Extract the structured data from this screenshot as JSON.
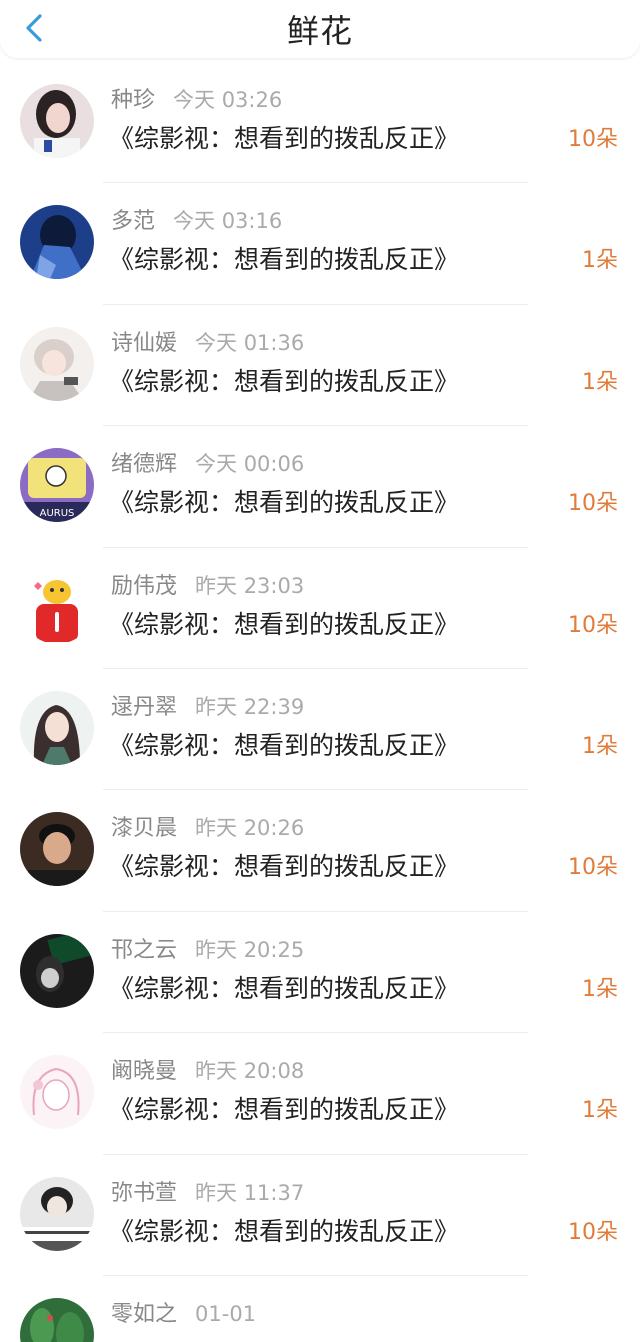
{
  "header": {
    "title": "鲜花"
  },
  "colors": {
    "accent_back": "#3a9bdc",
    "count_color": "#e07b39",
    "name_color": "#888888",
    "time_color": "#aaaaaa"
  },
  "items": [
    {
      "name": "种珍",
      "time": "今天 03:26",
      "title": "《综影视：想看到的拨乱反正》",
      "count": "10朵"
    },
    {
      "name": "多范",
      "time": "今天 03:16",
      "title": "《综影视：想看到的拨乱反正》",
      "count": "1朵"
    },
    {
      "name": "诗仙媛",
      "time": "今天 01:36",
      "title": "《综影视：想看到的拨乱反正》",
      "count": "1朵"
    },
    {
      "name": "绪德辉",
      "time": "今天 00:06",
      "title": "《综影视：想看到的拨乱反正》",
      "count": "10朵"
    },
    {
      "name": "励伟茂",
      "time": "昨天 23:03",
      "title": "《综影视：想看到的拨乱反正》",
      "count": "10朵"
    },
    {
      "name": "逯丹翠",
      "time": "昨天 22:39",
      "title": "《综影视：想看到的拨乱反正》",
      "count": "1朵"
    },
    {
      "name": "漆贝晨",
      "time": "昨天 20:26",
      "title": "《综影视：想看到的拨乱反正》",
      "count": "10朵"
    },
    {
      "name": "邗之云",
      "time": "昨天 20:25",
      "title": "《综影视：想看到的拨乱反正》",
      "count": "1朵"
    },
    {
      "name": "阚晓曼",
      "time": "昨天 20:08",
      "title": "《综影视：想看到的拨乱反正》",
      "count": "1朵"
    },
    {
      "name": "弥书萱",
      "time": "昨天 11:37",
      "title": "《综影视：想看到的拨乱反正》",
      "count": "10朵"
    },
    {
      "name": "零如之",
      "time": "01-01",
      "title": "",
      "count": ""
    }
  ]
}
